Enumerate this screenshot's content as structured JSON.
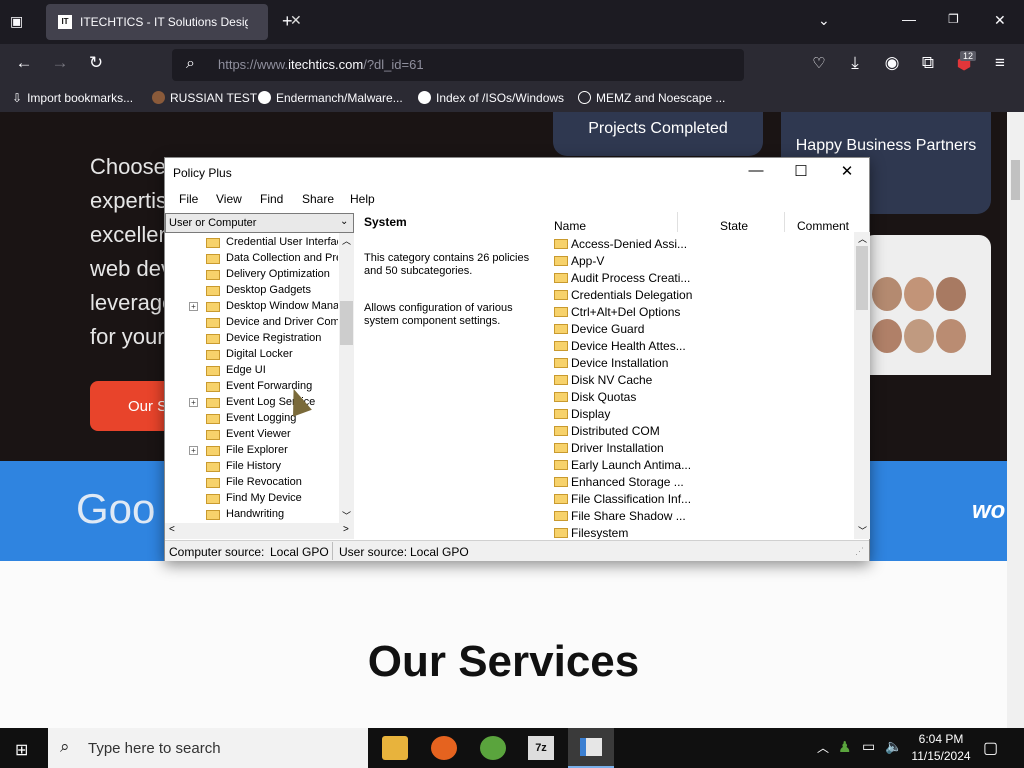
{
  "browser": {
    "tab_title": "ITECHTICS - IT Solutions Design",
    "favicon_text": "IT",
    "url_prefix": "https://www.",
    "url_domain": "itechtics.com",
    "url_suffix": "/?dl_id=61",
    "extension_badge": "12",
    "bookmarks": [
      "Import bookmarks...",
      "RUSSIAN TEST",
      "Endermanch/Malware...",
      "Index of /ISOs/Windows",
      "MEMZ and Noescape ..."
    ]
  },
  "site": {
    "hero_lines": [
      "Choose",
      "expertis",
      "excellen",
      "web dev",
      "leverage",
      "for your"
    ],
    "cta": "Our S",
    "stat1": "Projects Completed",
    "stat2": "Happy Business Partners",
    "logo_partial": "Goo",
    "wo_partial": "wo",
    "services": "Our Services"
  },
  "policy": {
    "title": "Policy Plus",
    "menu": [
      "File",
      "View",
      "Find",
      "Share",
      "Help"
    ],
    "combo": "User or Computer",
    "tree": [
      {
        "label": "Credential User Interfac",
        "exp": false
      },
      {
        "label": "Data Collection and Pre",
        "exp": false
      },
      {
        "label": "Delivery Optimization",
        "exp": false
      },
      {
        "label": "Desktop Gadgets",
        "exp": false
      },
      {
        "label": "Desktop Window Mana",
        "exp": true
      },
      {
        "label": "Device and Driver Comp",
        "exp": false
      },
      {
        "label": "Device Registration",
        "exp": false
      },
      {
        "label": "Digital Locker",
        "exp": false
      },
      {
        "label": "Edge UI",
        "exp": false
      },
      {
        "label": "Event Forwarding",
        "exp": false
      },
      {
        "label": "Event Log Service",
        "exp": true
      },
      {
        "label": "Event Logging",
        "exp": false
      },
      {
        "label": "Event Viewer",
        "exp": false
      },
      {
        "label": "File Explorer",
        "exp": true
      },
      {
        "label": "File History",
        "exp": false
      },
      {
        "label": "File Revocation",
        "exp": false
      },
      {
        "label": "Find My Device",
        "exp": false
      },
      {
        "label": "Handwriting",
        "exp": false
      }
    ],
    "desc_title": "System",
    "desc_1": "This category contains 26 policies and 50 subcategories.",
    "desc_2": "Allows configuration of various system component settings.",
    "columns": [
      "Name",
      "State",
      "Comment"
    ],
    "items": [
      "Access-Denied Assi...",
      "App-V",
      "Audit Process Creati...",
      "Credentials Delegation",
      "Ctrl+Alt+Del Options",
      "Device Guard",
      "Device Health Attes...",
      "Device Installation",
      "Disk NV Cache",
      "Disk Quotas",
      "Display",
      "Distributed COM",
      "Driver Installation",
      "Early Launch Antima...",
      "Enhanced Storage ...",
      "File Classification Inf...",
      "File Share Shadow ...",
      "Filesystem"
    ],
    "status_computer": "Computer source:",
    "status_computer_val": "Local GPO",
    "status_user": "User source:",
    "status_user_val": "Local GPO"
  },
  "taskbar": {
    "search_placeholder": "Type here to search",
    "time": "6:04 PM",
    "date": "11/15/2024"
  }
}
